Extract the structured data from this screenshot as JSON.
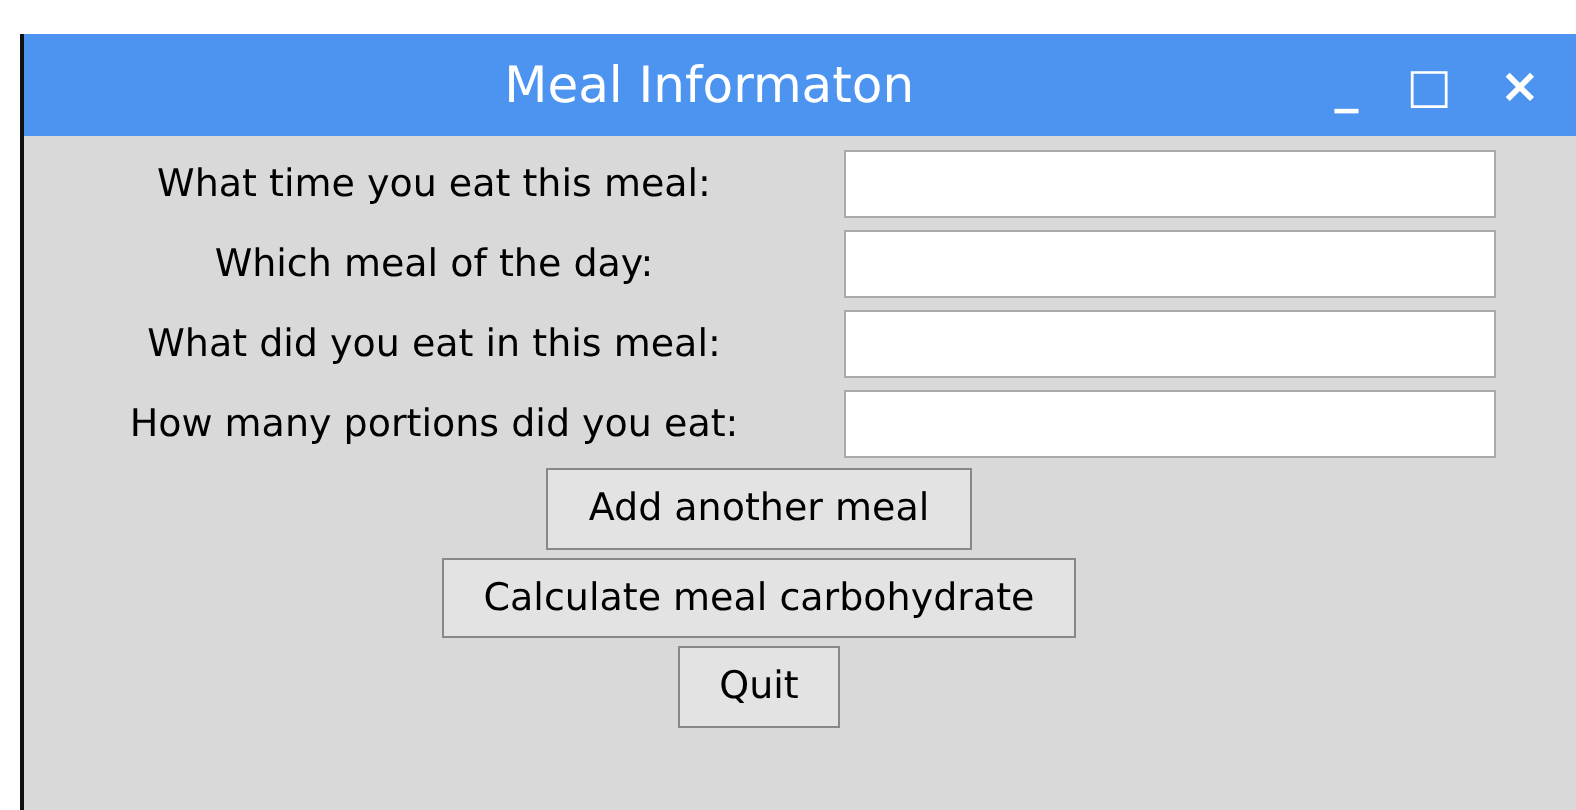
{
  "window": {
    "title": "Meal Informaton",
    "controls": [
      "_",
      "□",
      "×"
    ]
  },
  "fields": [
    {
      "label": "What time you eat this meal:"
    },
    {
      "label": "Which meal of the day:"
    },
    {
      "label": "What did you eat in this meal:"
    },
    {
      "label": "How many portions did you eat:"
    }
  ],
  "buttons": [
    "Add another meal",
    "Calculate meal carbohydrate",
    "Quit"
  ]
}
